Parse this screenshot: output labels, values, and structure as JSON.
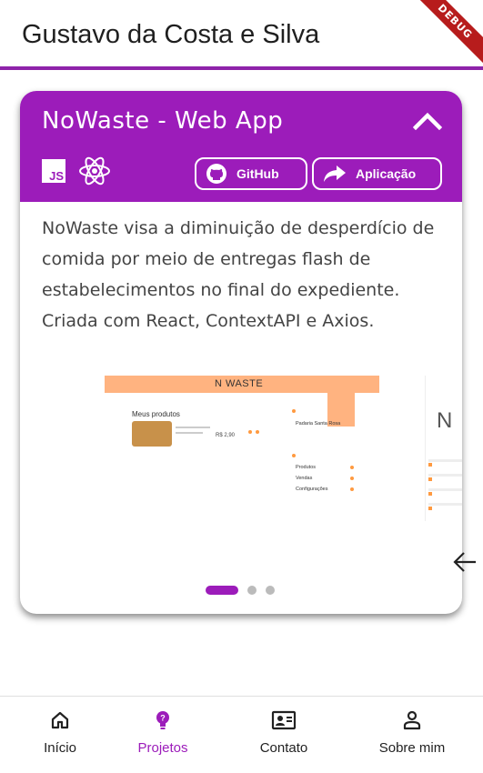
{
  "app_bar": {
    "title": "Gustavo da Costa e Silva"
  },
  "debug_banner": "DEBUG",
  "project_card": {
    "title": "NoWaste - Web App",
    "technologies": [
      "javascript-icon",
      "react-icon"
    ],
    "js_label": "JS",
    "buttons": {
      "github": "GitHub",
      "app": "Aplicação"
    },
    "description": "NoWaste visa a diminuição de desperdício de comida por meio de entregas flash de estabelecimentos no final do expediente. Criada com React, ContextAPI e Axios.",
    "carousel": {
      "slide_count": 3,
      "active_index": 0,
      "screenshot": {
        "logo": "N WASTE",
        "heading": "Meus produtos",
        "price": "R$ 2,90",
        "shop": "Padaria Santa Rosa",
        "side_items": [
          "Produtos",
          "Vendas",
          "Configurações"
        ]
      },
      "peek_letter": "N"
    }
  },
  "bottom_nav": {
    "active": "projetos",
    "items": [
      {
        "id": "inicio",
        "label": "Início",
        "icon": "home-icon"
      },
      {
        "id": "projetos",
        "label": "Projetos",
        "icon": "lightbulb-icon"
      },
      {
        "id": "contato",
        "label": "Contato",
        "icon": "contact-card-icon"
      },
      {
        "id": "sobre",
        "label": "Sobre mim",
        "icon": "person-icon"
      }
    ]
  },
  "colors": {
    "primary": "#9c1cba",
    "accent_line": "#8e24aa",
    "debug": "#b71c1c"
  }
}
